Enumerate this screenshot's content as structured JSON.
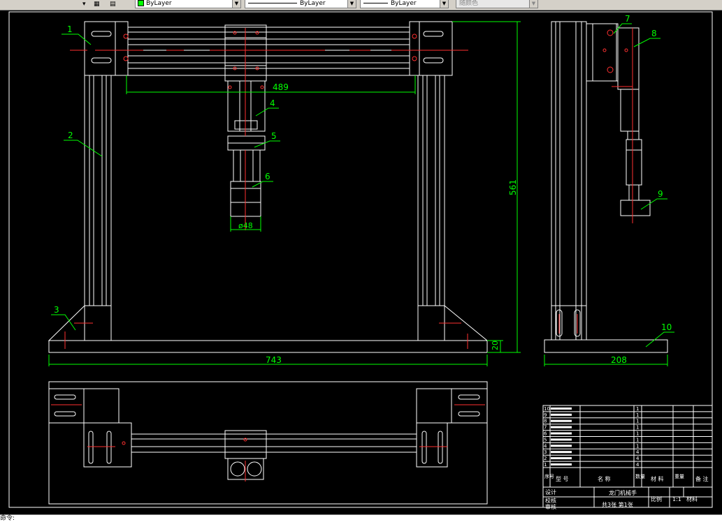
{
  "toolbar": {
    "layer_combo_1": "ByLayer",
    "layer_combo_2": "ByLayer",
    "layer_combo_3": "ByLayer",
    "color_combo": "随颜色"
  },
  "colors": {
    "background": "#000000",
    "lines": "#ffffff",
    "dimensions": "#00ff00",
    "center": "#ff0000"
  },
  "drawing": {
    "front_view": {
      "dim_width": "743",
      "dim_height": "561",
      "dim_base": "20",
      "dim_span": "489",
      "dim_dia": "ø48",
      "callouts": [
        "1",
        "2",
        "3",
        "4",
        "5",
        "6"
      ]
    },
    "side_view": {
      "dim_width": "208",
      "callouts": [
        "7",
        "8",
        "9",
        "10"
      ]
    },
    "title_block": {
      "rows": [
        {
          "no": "10",
          "qty": "1"
        },
        {
          "no": "9",
          "qty": "1"
        },
        {
          "no": "8",
          "qty": "1"
        },
        {
          "no": "7",
          "qty": "1"
        },
        {
          "no": "6",
          "qty": "1"
        },
        {
          "no": "5",
          "qty": "1"
        },
        {
          "no": "4",
          "qty": "1"
        },
        {
          "no": "3",
          "qty": "4"
        },
        {
          "no": "2",
          "qty": "4"
        },
        {
          "no": "1",
          "qty": "4"
        }
      ],
      "header_xuhao": "序号",
      "header_xinghao": "型 号",
      "header_mingcheng": "名 称",
      "header_shuliang": "数量",
      "header_cailiao": "材 料",
      "header_zhongliang": "重量",
      "header_beizhu": "备 注",
      "sheji": "设计",
      "jiaohe": "校核",
      "shenhe": "审核",
      "title": "龙门机械手",
      "scale_label": "比例",
      "scale": "1:1",
      "material_label": "材料",
      "sheets": "共3张 第1张"
    }
  },
  "command_line": "命令:"
}
